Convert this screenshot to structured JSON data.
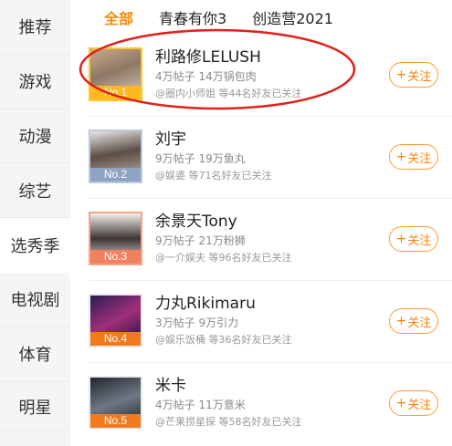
{
  "sidebar": {
    "items": [
      {
        "label": "推荐"
      },
      {
        "label": "游戏"
      },
      {
        "label": "动漫"
      },
      {
        "label": "综艺"
      },
      {
        "label": "选秀季"
      },
      {
        "label": "电视剧"
      },
      {
        "label": "体育"
      },
      {
        "label": "明星"
      }
    ]
  },
  "tabs": [
    {
      "label": "全部"
    },
    {
      "label": "青春有你3"
    },
    {
      "label": "创造营2021"
    }
  ],
  "list": [
    {
      "name": "利路修LELUSH",
      "stats": "4万帖子 14万锅包肉",
      "friends": "@圈内小师姐 等44名好友已关注",
      "rank": "No.1",
      "follow_label": "关注"
    },
    {
      "name": "刘宇",
      "stats": "9万帖子 19万鱼丸",
      "friends": "@娱婆 等71名好友已关注",
      "rank": "No.2",
      "follow_label": "关注"
    },
    {
      "name": "余景天Tony",
      "stats": "9万帖子 21万粉狮",
      "friends": "@一介娱夫 等96名好友已关注",
      "rank": "No.3",
      "follow_label": "关注"
    },
    {
      "name": "力丸Rikimaru",
      "stats": "3万帖子 9万引力",
      "friends": "@娱乐饭桶 等36名好友已关注",
      "rank": "No.4",
      "follow_label": "关注"
    },
    {
      "name": "米卡",
      "stats": "4万帖子 11万意米",
      "friends": "@芒果捞星探 等58名好友已关注",
      "rank": "No.5",
      "follow_label": "关注"
    }
  ],
  "colors": {
    "accent": "#ff8800",
    "annotation": "#e0201b"
  },
  "icons": {
    "follow": "plus-icon",
    "rank_badge": "crown-icon"
  }
}
